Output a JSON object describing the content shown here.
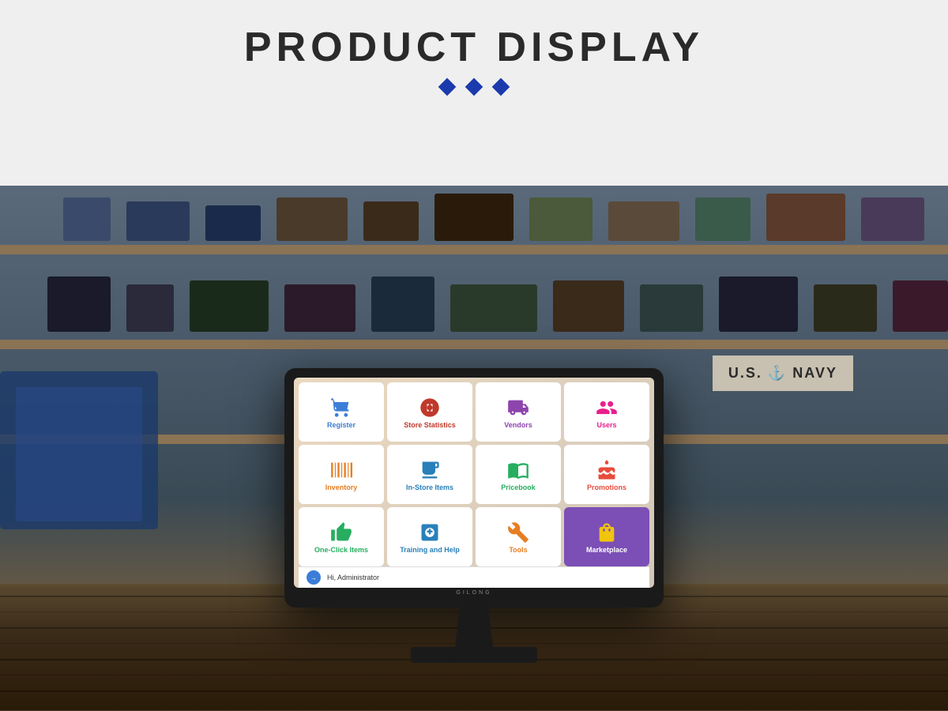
{
  "header": {
    "title": "PRODUCT DISPLAY",
    "diamonds_count": 3,
    "diamond_color": "#1a3aad"
  },
  "monitor": {
    "brand": "GILONG",
    "status_bar": {
      "user_label": "Hi, Administrator",
      "avatar_text": "→"
    }
  },
  "app_grid": {
    "tiles": [
      {
        "id": "register",
        "label": "Register",
        "icon_type": "cart",
        "icon_color": "#3b7dd8",
        "label_color": "#3b7dd8",
        "bg": "white"
      },
      {
        "id": "store-statistics",
        "label": "Store Statistics",
        "icon_type": "gauge",
        "icon_color": "#c0392b",
        "label_color": "#c0392b",
        "bg": "white"
      },
      {
        "id": "vendors",
        "label": "Vendors",
        "icon_type": "truck",
        "icon_color": "#8e44ad",
        "label_color": "#8e44ad",
        "bg": "white"
      },
      {
        "id": "users",
        "label": "Users",
        "icon_type": "users",
        "icon_color": "#e91e8c",
        "label_color": "#e91e8c",
        "bg": "white"
      },
      {
        "id": "inventory",
        "label": "Inventory",
        "icon_type": "barcode",
        "icon_color": "#e67e22",
        "label_color": "#e67e22",
        "bg": "white"
      },
      {
        "id": "instore-items",
        "label": "In-Store Items",
        "icon_type": "cup",
        "icon_color": "#2980b9",
        "label_color": "#2980b9",
        "bg": "white"
      },
      {
        "id": "pricebook",
        "label": "Pricebook",
        "icon_type": "book",
        "icon_color": "#27ae60",
        "label_color": "#27ae60",
        "bg": "white"
      },
      {
        "id": "promotions",
        "label": "Promotions",
        "icon_type": "cake",
        "icon_color": "#e74c3c",
        "label_color": "#e74c3c",
        "bg": "white"
      },
      {
        "id": "one-click-items",
        "label": "One-Click Items",
        "icon_type": "thumb",
        "icon_color": "#27ae60",
        "label_color": "#27ae60",
        "bg": "white"
      },
      {
        "id": "training-and-help",
        "label": "Training and Help",
        "icon_type": "ambulance",
        "icon_color": "#2980b9",
        "label_color": "#2980b9",
        "bg": "white"
      },
      {
        "id": "tools",
        "label": "Tools",
        "icon_type": "wrench",
        "icon_color": "#e67e22",
        "label_color": "#e67e22",
        "bg": "white"
      },
      {
        "id": "marketplace",
        "label": "Marketplace",
        "icon_type": "bag",
        "icon_color": "#f1c40f",
        "label_color": "white",
        "bg": "#7b4fb5"
      }
    ]
  }
}
